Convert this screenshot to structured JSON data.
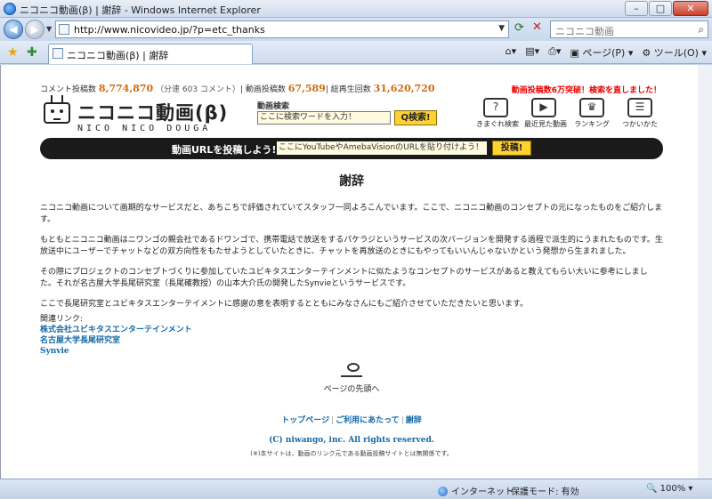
{
  "window": {
    "title": "ニコニコ動画(β) | 謝辞 - Windows Internet Explorer",
    "minimize": "–",
    "maximize": "□",
    "close": "✕"
  },
  "address": {
    "url": "http://www.nicovideo.jp/?p=etc_thanks",
    "search_placeholder": "ニコニコ動画"
  },
  "tab": {
    "label": "ニコニコ動画(β) | 謝辞"
  },
  "commands": {
    "page": "ページ(P)",
    "tools": "ツール(O)"
  },
  "site": {
    "stats": {
      "comments_label": "コメント投稿数",
      "comments_value": "8,774,870",
      "per_minute": "（分速 603 コメント）",
      "videos_label": "動画投稿数",
      "videos_value": "67,589",
      "plays_label": "総再生回数",
      "plays_value": "31,620,720"
    },
    "notice": "動画投稿数6万突破！検索を直しました！",
    "logo_jp": "ニコニコ動画(β)",
    "logo_en": "NICO NICO DOUGA",
    "video_search": {
      "label": "動画検索",
      "placeholder": "ここに検索ワードを入力！",
      "button": "Q検索!"
    },
    "nav_icons": [
      {
        "label": "きまぐれ検索",
        "icon": "random-search-icon"
      },
      {
        "label": "最近見た動画",
        "icon": "recent-videos-icon"
      },
      {
        "label": "ランキング",
        "icon": "ranking-icon"
      },
      {
        "label": "つかいかた",
        "icon": "howto-icon"
      }
    ],
    "post_bar": {
      "label": "動画URLを投稿しよう!",
      "placeholder": "ここにYouTubeやAmebaVisionのURLを貼り付けよう！",
      "button": "投稿!"
    },
    "heading": "謝辞",
    "paragraphs": [
      "ニコニコ動画について画期的なサービスだと、あちこちで評価されていてスタッフ一同よろこんでいます。ここで、ニコニコ動画のコンセプトの元になったものをご紹介します。",
      "もともとニコニコ動画はニワンゴの親会社であるドワンゴで、携帯電話で放送をするパケラジというサービスの次バージョンを開発する過程で派生的にうまれたものです。生放送中にユーザーでチャットなどの双方向性をもたせようとしていたときに、チャットを再放送のときにもやってもいいんじゃないかという発想から生まれました。",
      "その際にプロジェクトのコンセプトづくりに参加していたユビキタスエンターテインメントに似たようなコンセプトのサービスがあると教えてもらい大いに参考にしました。それが名古屋大学長尾研究室（長尾確教授）の山本大介氏の開発したSynvieというサービスです。",
      "ここで長尾研究室とユビキタスエンターテイメントに感謝の意を表明するとともにみなさんにもご紹介させていただきたいと思います。"
    ],
    "related_label": "関連リンク:",
    "related_links": [
      "株式会社ユビキタスエンターテインメント",
      "名古屋大学長尾研究室",
      "Synvie"
    ],
    "to_top": "ページの先頭へ",
    "footer_links": [
      "トップページ",
      "ご利用にあたって",
      "謝辞"
    ],
    "copyright": "(C) niwango, inc. All rights reserved.",
    "disclaimer": "(※)本サイトは、動画のリンク元である動画投稿サイトとは無関係です。"
  },
  "status": {
    "zone": "インターネット",
    "protected_mode": "保護モード: 有効",
    "zoom": "100%"
  }
}
